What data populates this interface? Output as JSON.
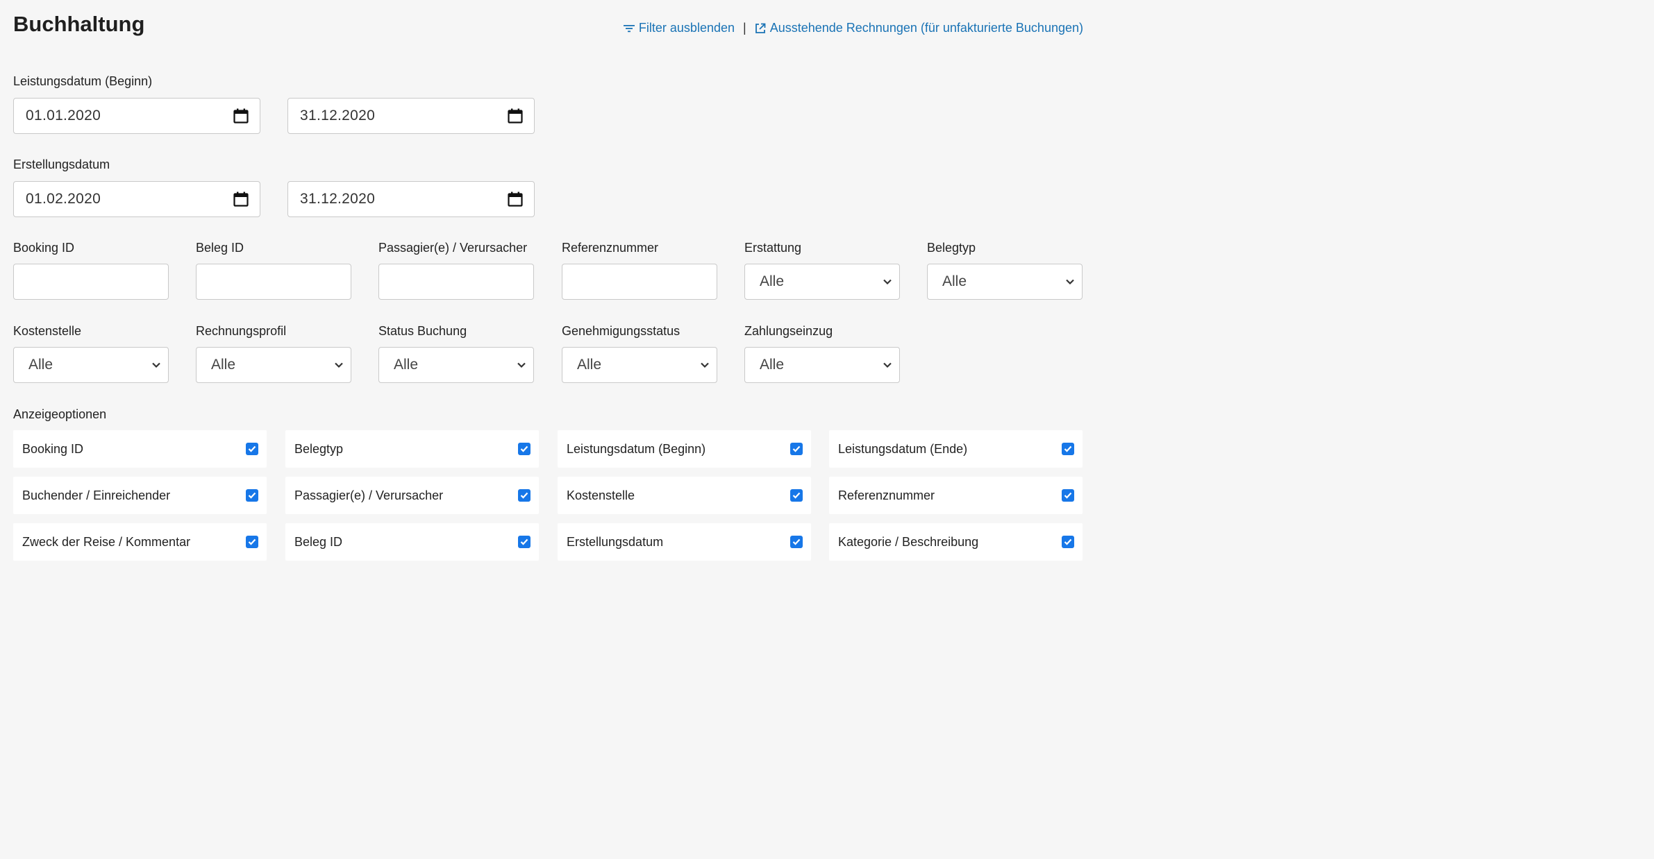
{
  "header": {
    "title": "Buchhaltung",
    "filter_toggle": "Filter ausblenden",
    "separator": "|",
    "pending_invoices": "Ausstehende Rechnungen (für unfakturierte Buchungen)"
  },
  "service_date": {
    "label": "Leistungsdatum (Beginn)",
    "from": "01.01.2020",
    "to": "31.12.2020"
  },
  "created_date": {
    "label": "Erstellungsdatum",
    "from": "01.02.2020",
    "to": "31.12.2020"
  },
  "text_filters": [
    {
      "label": "Booking ID",
      "value": ""
    },
    {
      "label": "Beleg ID",
      "value": ""
    },
    {
      "label": "Passagier(e) / Verursacher",
      "value": ""
    },
    {
      "label": "Referenznummer",
      "value": ""
    }
  ],
  "select_filters_row1": [
    {
      "label": "Erstattung",
      "value": "Alle"
    },
    {
      "label": "Belegtyp",
      "value": "Alle"
    }
  ],
  "select_filters_row2": [
    {
      "label": "Kostenstelle",
      "value": "Alle"
    },
    {
      "label": "Rechnungsprofil",
      "value": "Alle"
    },
    {
      "label": "Status Buchung",
      "value": "Alle"
    },
    {
      "label": "Genehmigungsstatus",
      "value": "Alle"
    },
    {
      "label": "Zahlungseinzug",
      "value": "Alle"
    }
  ],
  "display_options": {
    "label": "Anzeigeoptionen",
    "items": [
      {
        "label": "Booking ID",
        "checked": true
      },
      {
        "label": "Belegtyp",
        "checked": true
      },
      {
        "label": "Leistungsdatum (Beginn)",
        "checked": true
      },
      {
        "label": "Leistungsdatum (Ende)",
        "checked": true
      },
      {
        "label": "Buchender / Einreichender",
        "checked": true
      },
      {
        "label": "Passagier(e) / Verursacher",
        "checked": true
      },
      {
        "label": "Kostenstelle",
        "checked": true
      },
      {
        "label": "Referenznummer",
        "checked": true
      },
      {
        "label": "Zweck der Reise / Kommentar",
        "checked": true
      },
      {
        "label": "Beleg ID",
        "checked": true
      },
      {
        "label": "Erstellungsdatum",
        "checked": true
      },
      {
        "label": "Kategorie / Beschreibung",
        "checked": true
      }
    ]
  },
  "colors": {
    "link": "#1a73b5",
    "checkbox": "#1777e8",
    "background": "#f6f6f6"
  }
}
